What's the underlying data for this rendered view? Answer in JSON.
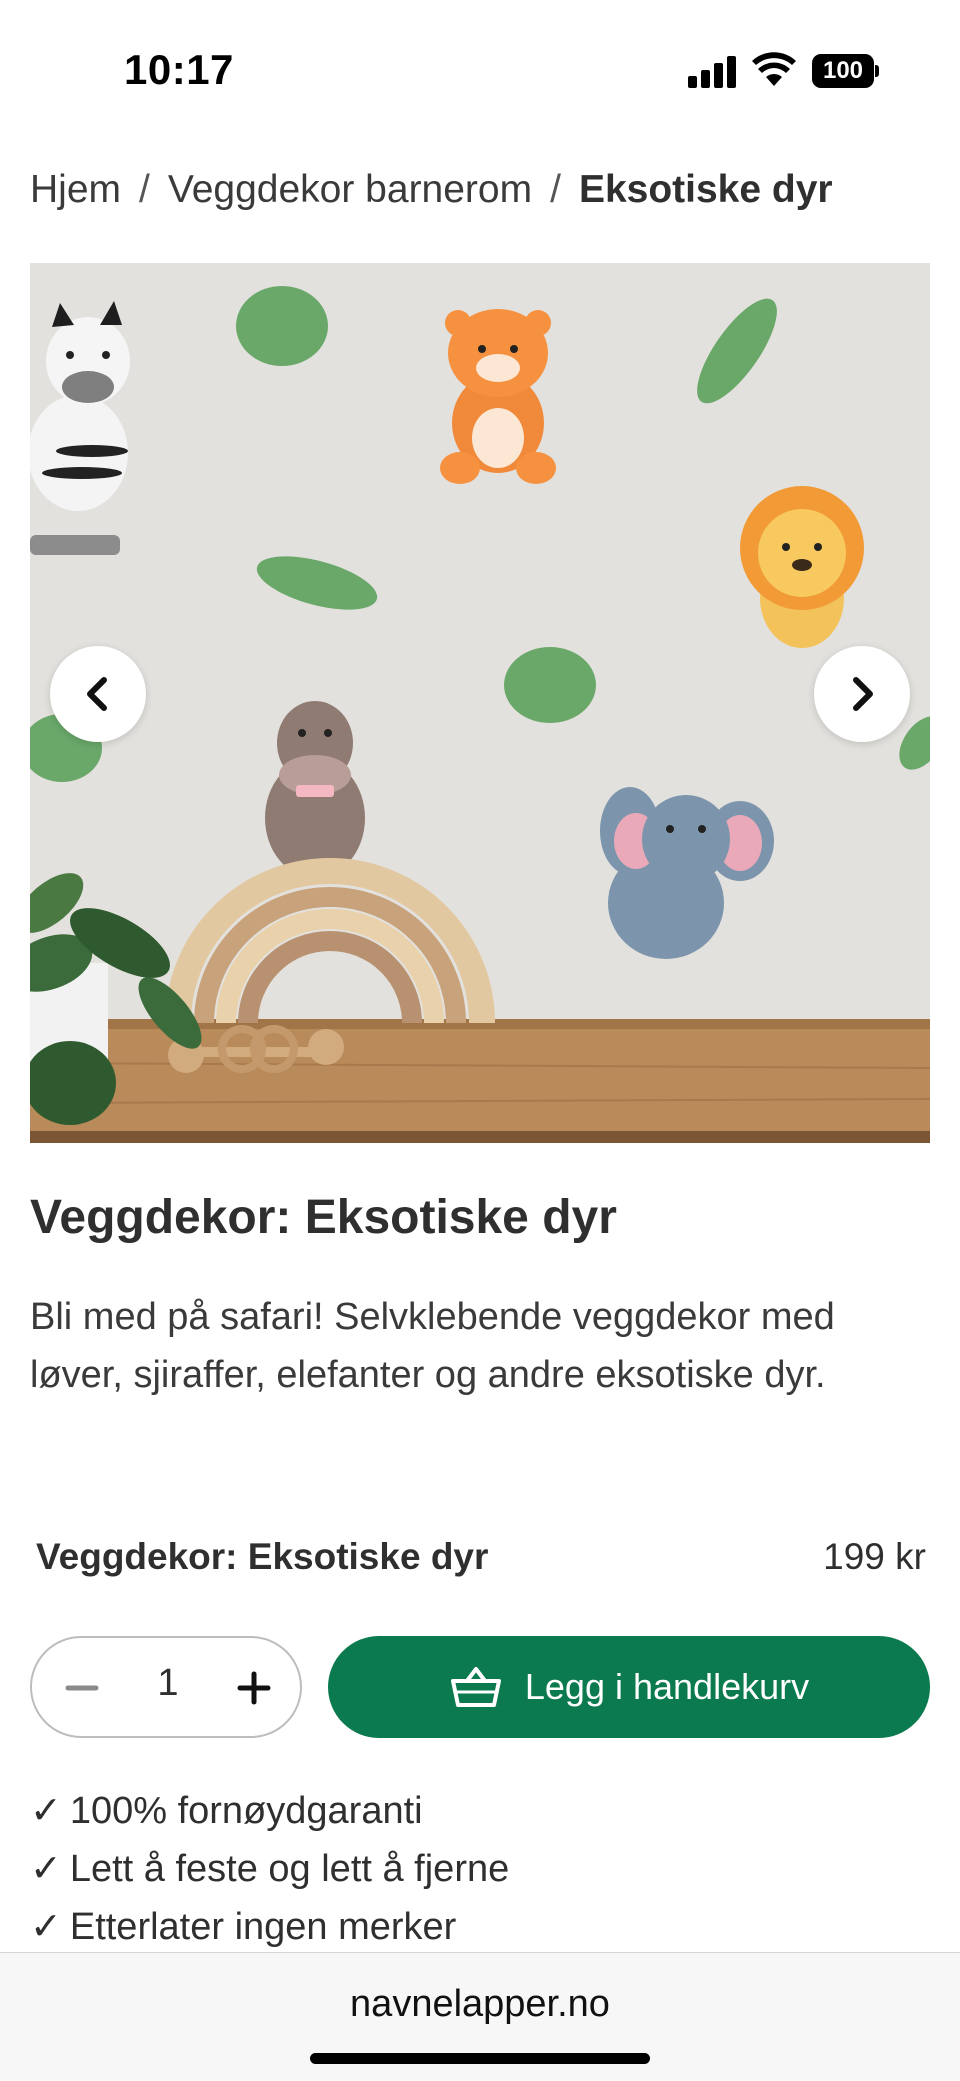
{
  "status_bar": {
    "time": "10:17",
    "battery": "100",
    "icons": [
      "cellular-signal-icon",
      "wifi-icon",
      "battery-icon"
    ]
  },
  "breadcrumb": {
    "items": [
      "Hjem",
      "Veggdekor barnerom",
      "Eksotiske dyr"
    ],
    "separator": "/"
  },
  "gallery": {
    "icons": [
      "chevron-left-icon",
      "chevron-right-icon"
    ]
  },
  "product": {
    "title": "Veggdekor: Eksotiske dyr",
    "description": "Bli med på safari! Selvklebende veggdekor med løver, sjiraffer, elefanter og andre eksotiske dyr."
  },
  "variant": {
    "name": "Veggdekor: Eksotiske dyr",
    "price": "199 kr"
  },
  "quantity": {
    "value": "1",
    "icons": [
      "minus-icon",
      "plus-icon"
    ]
  },
  "add_to_cart": {
    "label": "Legg i handlekurv",
    "icon": "basket-icon",
    "color": "#0b7a4e"
  },
  "benefits": {
    "check": "✓",
    "items": [
      "100% fornøydgaranti",
      "Lett å feste og lett å fjerne",
      "Etterlater ingen merker"
    ]
  },
  "browser": {
    "url": "navnelapper.no"
  }
}
